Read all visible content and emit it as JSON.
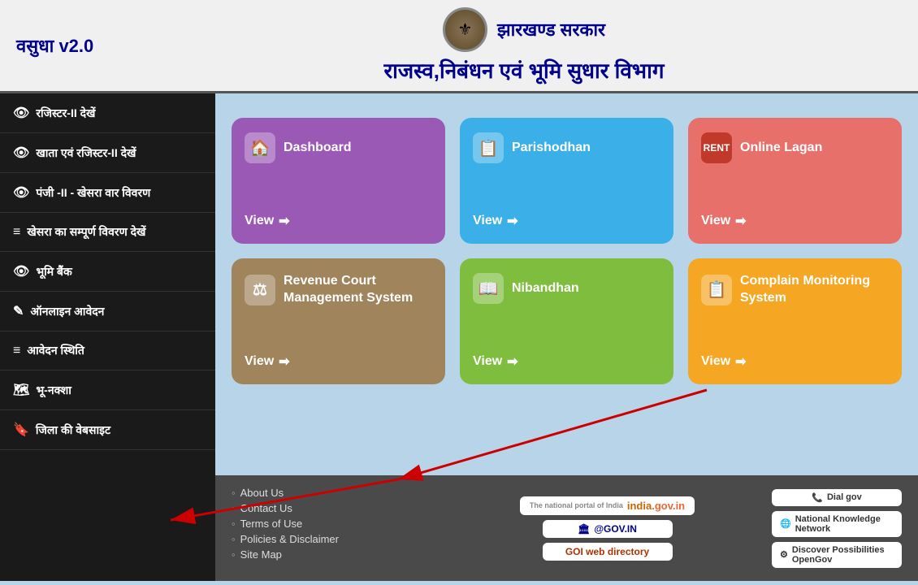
{
  "header": {
    "logo_text": "वसुधा v2.0",
    "gov_name": "झारखण्ड सरकार",
    "dept_name": "राजस्व,निबंधन एवं भूमि सुधार विभाग"
  },
  "sidebar": {
    "items": [
      {
        "id": "register2",
        "icon": "👁",
        "label": "रजिस्टर-II देखें"
      },
      {
        "id": "khata-register2",
        "icon": "👁",
        "label": "खाता एवं रजिस्टर-II देखें"
      },
      {
        "id": "panji2",
        "icon": "👁",
        "label": "पंजी -II - खेसरा वार विवरण"
      },
      {
        "id": "khesra-full",
        "icon": "≡",
        "label": "खेसरा का सम्पूर्ण विवरण देखें"
      },
      {
        "id": "bhumi-bank",
        "icon": "👁",
        "label": "भूमि बैंक"
      },
      {
        "id": "online-aavedan",
        "icon": "✎",
        "label": "ऑनलाइन आवेदन"
      },
      {
        "id": "aavedan-sthiti",
        "icon": "≡",
        "label": "आवेदन स्थिति"
      },
      {
        "id": "bhu-naksha",
        "icon": "🗺",
        "label": "भू-नक्शा"
      },
      {
        "id": "jila-website",
        "icon": "🔖",
        "label": "जिला की वेबसाइट"
      }
    ]
  },
  "cards": [
    {
      "id": "dashboard",
      "title": "Dashboard",
      "view_label": "View",
      "color_class": "card-dashboard",
      "icon": "🏠"
    },
    {
      "id": "parishodhan",
      "title": "Parishodhan",
      "view_label": "View",
      "color_class": "card-parishodhan",
      "icon": "📋"
    },
    {
      "id": "online-lagan",
      "title": "Online Lagan",
      "view_label": "View",
      "color_class": "card-lagan",
      "icon": "🏷"
    },
    {
      "id": "revenue-court",
      "title": "Revenue Court Management System",
      "view_label": "View",
      "color_class": "card-revenue",
      "icon": "⚖"
    },
    {
      "id": "nibandhan",
      "title": "Nibandhan",
      "view_label": "View",
      "color_class": "card-nibandhan",
      "icon": "📖"
    },
    {
      "id": "complain-monitoring",
      "title": "Complain Monitoring System",
      "view_label": "View",
      "color_class": "card-complain",
      "icon": "📋"
    }
  ],
  "footer": {
    "links": [
      {
        "label": "About Us"
      },
      {
        "label": "Contact Us"
      },
      {
        "label": "Terms of Use"
      },
      {
        "label": "Policies & Disclaimer"
      },
      {
        "label": "Site Map"
      }
    ],
    "badges_middle": [
      {
        "label": "india.gov.in",
        "sub": "The national portal of India"
      },
      {
        "label": "@GOV.IN"
      },
      {
        "label": "GOI web directory"
      }
    ],
    "badges_right": [
      {
        "label": "Dial gov"
      },
      {
        "label": "National Knowledge Network"
      },
      {
        "label": "Discover Possibilities OpenGov"
      }
    ]
  }
}
